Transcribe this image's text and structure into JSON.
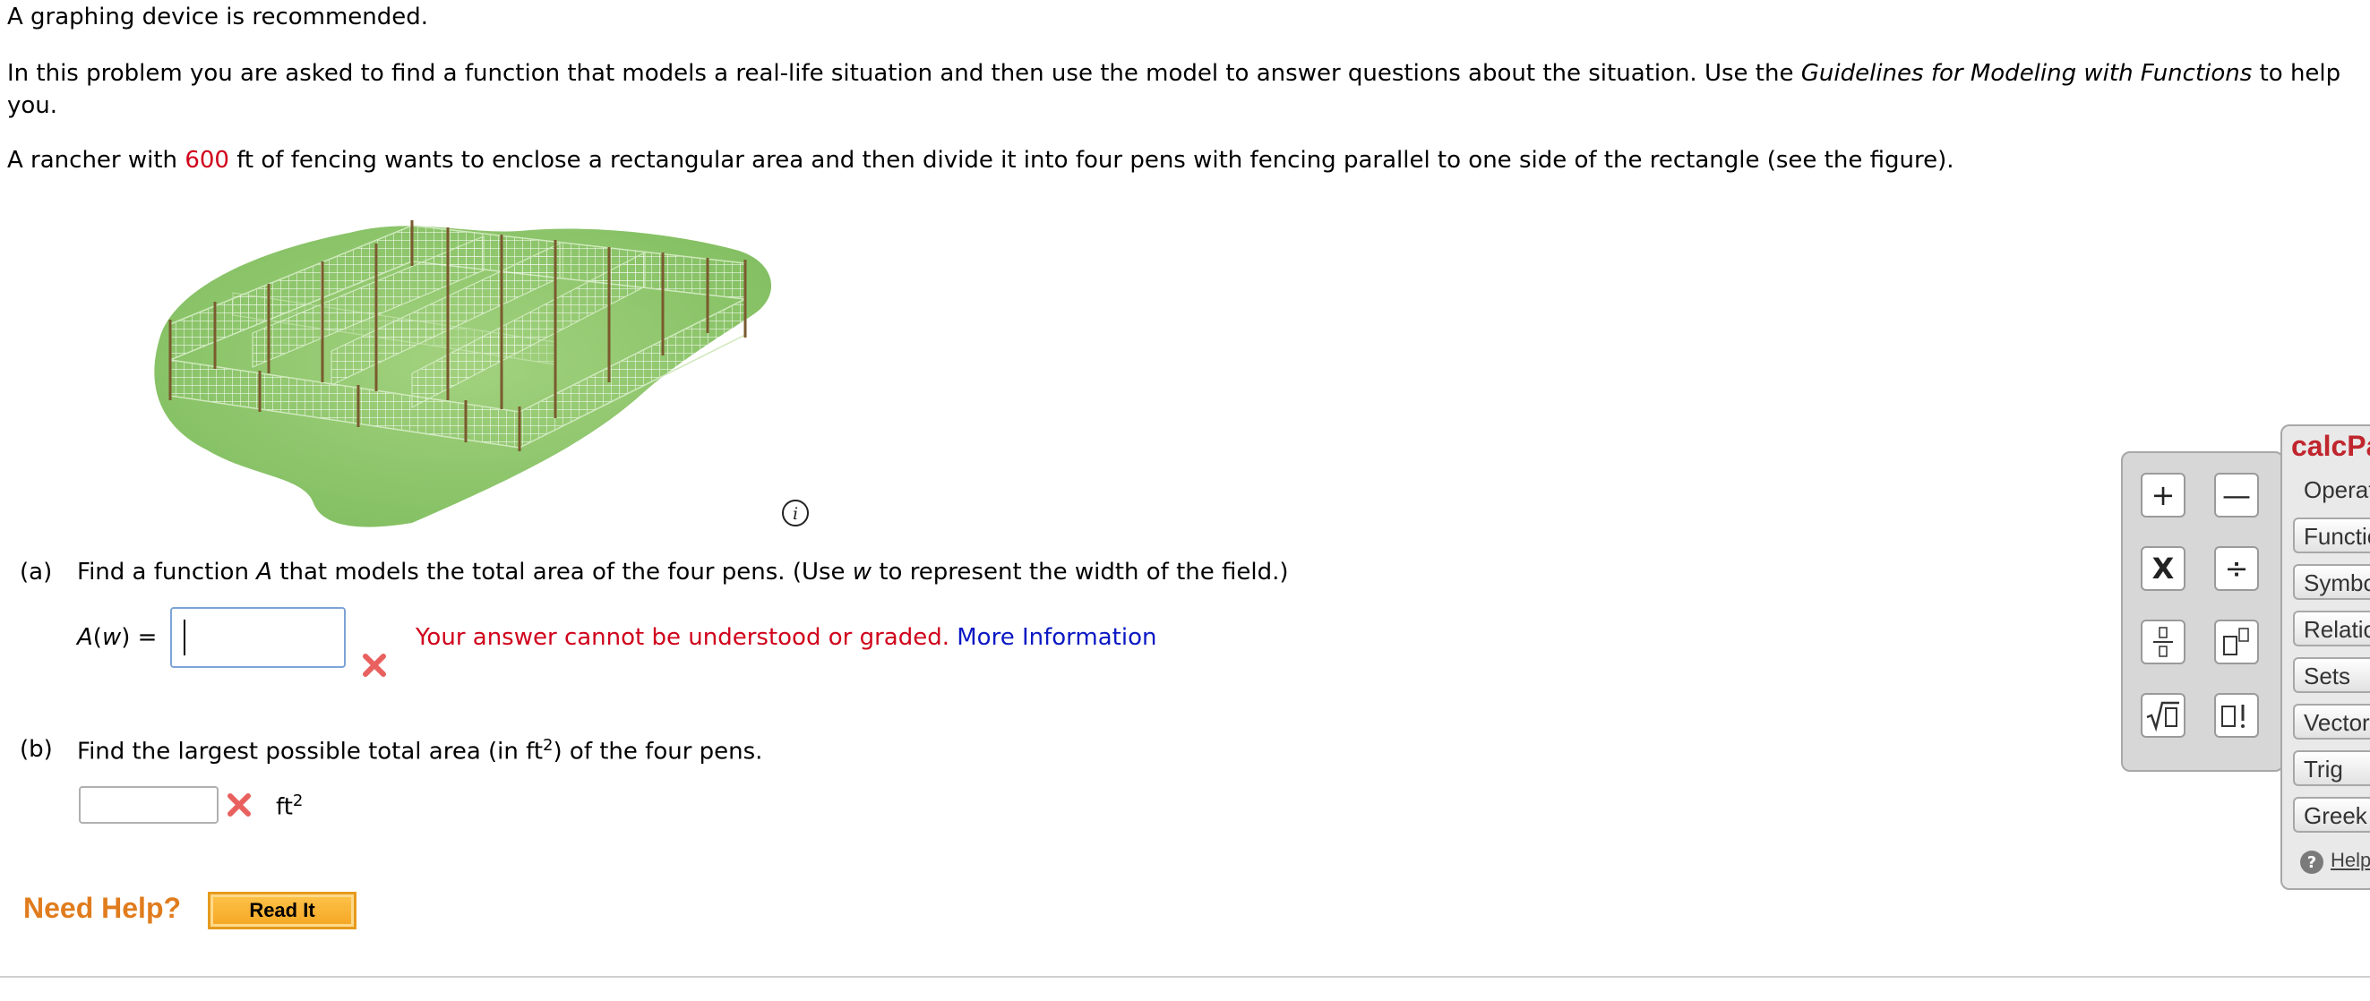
{
  "intro": {
    "recommend": "A graphing device is recommended.",
    "paragraph_start": "In this problem you are asked to find a function that models a real-life situation and then use the model to answer questions about the situation. Use the ",
    "guidelines": "Guidelines for Modeling with Functions",
    "paragraph_end": " to help you."
  },
  "rancher": {
    "before": "A rancher with ",
    "feet": "600",
    "after": " ft of fencing wants to enclose a rectangular area and then divide it into four pens with fencing parallel to one side of the rectangle (see the figure)."
  },
  "part_a": {
    "label": "(a)",
    "text_1": "Find a function ",
    "var_A": "A",
    "text_2": " that models the total area of the four pens. (Use ",
    "var_w": "w",
    "text_3": " to represent the width of the field.)",
    "fn_A": "A",
    "fn_rest": "(",
    "fn_w": "w",
    "fn_end": ") =",
    "error_msg": "Your answer cannot be understood or graded.",
    "more_info": "More Information"
  },
  "part_b": {
    "label": "(b)",
    "text_1": "Find the largest possible total area (in ft",
    "sup": "2",
    "text_2": ") of the four pens.",
    "unit": "ft",
    "unit_sup": "2"
  },
  "help": {
    "label": "Need Help?",
    "read_it": "Read It"
  },
  "palette": {
    "plus": "+",
    "minus": "—",
    "times": "X",
    "divide": "÷",
    "fraction": "▯/▯",
    "power": "▯▯",
    "sqrt": "√▯",
    "factorial": "▯!"
  },
  "calc_panel": {
    "title": "calcPad",
    "tabs": [
      "Operations",
      "Functions",
      "Symbols",
      "Relations",
      "Sets",
      "Vectors",
      "Trig",
      "Greek"
    ],
    "help": "Help"
  },
  "colors": {
    "error": "#d0021b",
    "link": "#0a18c4",
    "help_orange": "#e07c1e",
    "grass": "#8cc56a"
  }
}
